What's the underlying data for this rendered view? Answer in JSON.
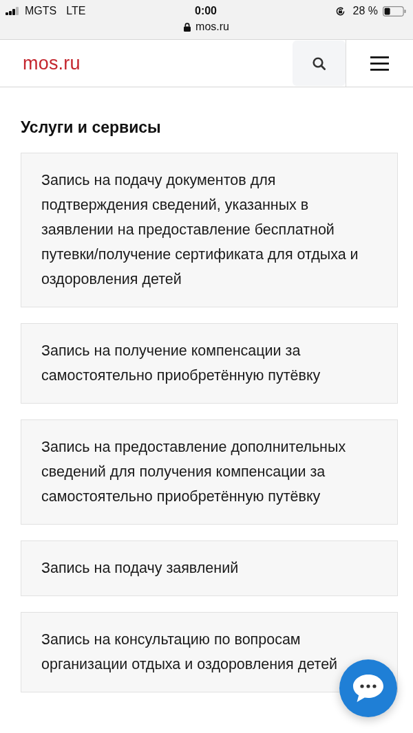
{
  "status_bar": {
    "carrier": "MGTS",
    "network": "LTE",
    "time": "0:00",
    "battery": "28 %",
    "url": "mos.ru"
  },
  "header": {
    "logo": "mos.ru"
  },
  "services": {
    "title": "Услуги и сервисы",
    "items": [
      {
        "text": "Запись на подачу документов для подтверждения сведений, указанных в заявлении на предоставление бесплатной путевки/получение сертификата для отдыха и оздоровления детей"
      },
      {
        "text": "Запись на получение компенсации за самостоятельно приобретённую путёвку"
      },
      {
        "text": "Запись на предоставление дополнительных сведений для получения компенсации за самостоятельно приобретённую путёвку"
      },
      {
        "text": "Запись на подачу заявлений"
      },
      {
        "text": "Запись на консультацию по вопросам организации отдыха и оздоровления детей"
      }
    ]
  }
}
